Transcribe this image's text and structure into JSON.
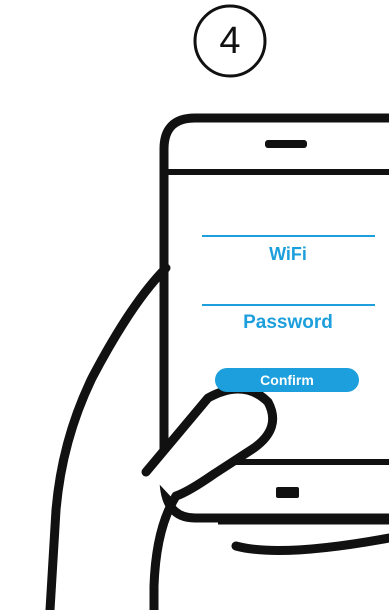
{
  "step": {
    "number": "4"
  },
  "form": {
    "wifi_label": "WiFi",
    "password_label": "Password",
    "confirm_label": "Confirm"
  },
  "colors": {
    "accent": "#1c9fdc",
    "outline": "#111111",
    "background": "#ffffff"
  },
  "icons": {
    "step_badge": "circle-outline-icon",
    "phone": "smartphone-icon",
    "hand": "hand-holding-icon"
  }
}
